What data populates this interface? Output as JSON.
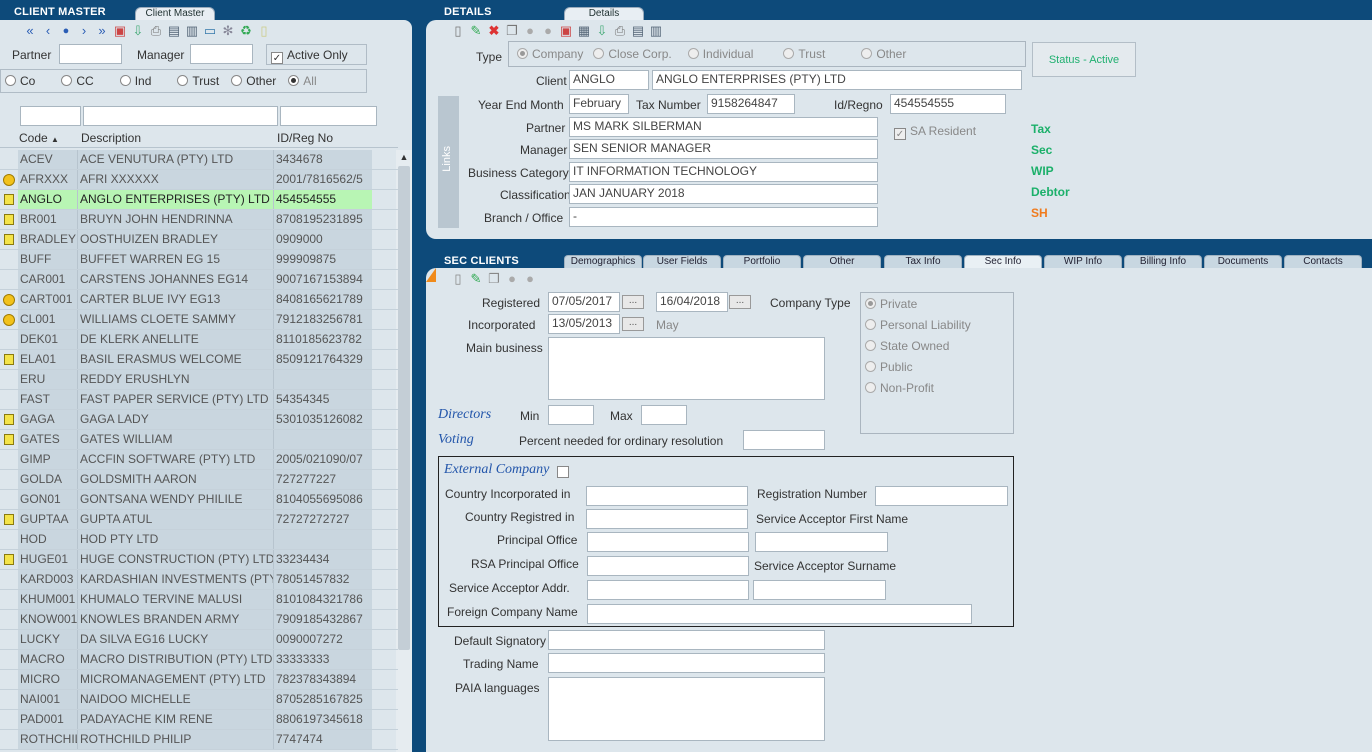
{
  "client_master": {
    "title": "CLIENT MASTER",
    "tab": "Client Master",
    "filters": {
      "partner_label": "Partner",
      "partner_value": "",
      "manager_label": "Manager",
      "manager_value": "",
      "active_only_label": "Active Only",
      "type_options": [
        "Co",
        "CC",
        "Ind",
        "Trust",
        "Other",
        "All"
      ],
      "type_selected": "All"
    },
    "columns": [
      "Code",
      "Description",
      "ID/Reg No"
    ],
    "rows": [
      {
        "icon": "",
        "code": "ACEV",
        "desc": "ACE VENUTURA (PTY) LTD",
        "id": "3434678"
      },
      {
        "icon": "face",
        "code": "AFRXXX",
        "desc": "AFRI XXXXXX",
        "id": "2001/7816562/5"
      },
      {
        "icon": "note",
        "code": "ANGLO",
        "desc": "ANGLO ENTERPRISES (PTY) LTD",
        "id": "454554555"
      },
      {
        "icon": "note",
        "code": "BR001",
        "desc": "BRUYN JOHN HENDRINNA",
        "id": "8708195231895"
      },
      {
        "icon": "note",
        "code": "BRADLEY",
        "desc": "OOSTHUIZEN BRADLEY",
        "id": "0909000"
      },
      {
        "icon": "",
        "code": "BUFF",
        "desc": "BUFFET WARREN EG 15",
        "id": "999909875"
      },
      {
        "icon": "",
        "code": "CAR001",
        "desc": "CARSTENS JOHANNES EG14",
        "id": "9007167153894"
      },
      {
        "icon": "face",
        "code": "CART001",
        "desc": "CARTER BLUE IVY EG13",
        "id": "8408165621789"
      },
      {
        "icon": "face",
        "code": "CL001",
        "desc": "WILLIAMS CLOETE SAMMY",
        "id": "7912183256781"
      },
      {
        "icon": "",
        "code": "DEK01",
        "desc": "DE KLERK ANELLITE",
        "id": "8110185623782"
      },
      {
        "icon": "note",
        "code": "ELA01",
        "desc": "BASIL ERASMUS WELCOME",
        "id": "8509121764329"
      },
      {
        "icon": "",
        "code": "ERU",
        "desc": "REDDY ERUSHLYN",
        "id": ""
      },
      {
        "icon": "",
        "code": "FAST",
        "desc": "FAST PAPER SERVICE (PTY) LTD",
        "id": "54354345"
      },
      {
        "icon": "note",
        "code": "GAGA",
        "desc": "GAGA LADY",
        "id": "5301035126082"
      },
      {
        "icon": "note",
        "code": "GATES",
        "desc": "GATES WILLIAM",
        "id": ""
      },
      {
        "icon": "",
        "code": "GIMP",
        "desc": "ACCFIN SOFTWARE (PTY) LTD",
        "id": "2005/021090/07"
      },
      {
        "icon": "",
        "code": "GOLDA",
        "desc": "GOLDSMITH AARON",
        "id": "727277227"
      },
      {
        "icon": "",
        "code": "GON01",
        "desc": "GONTSANA WENDY PHILILE",
        "id": "8104055695086"
      },
      {
        "icon": "note",
        "code": "GUPTAA",
        "desc": "GUPTA ATUL",
        "id": "72727272727"
      },
      {
        "icon": "",
        "code": "HOD",
        "desc": "HOD PTY LTD",
        "id": ""
      },
      {
        "icon": "note",
        "code": "HUGE01",
        "desc": "HUGE CONSTRUCTION (PTY) LTD",
        "id": "33234434"
      },
      {
        "icon": "",
        "code": "KARD003",
        "desc": "KARDASHIAN INVESTMENTS (PTY",
        "id": "78051457832"
      },
      {
        "icon": "",
        "code": "KHUM001",
        "desc": "KHUMALO TERVINE MALUSI",
        "id": "8101084321786"
      },
      {
        "icon": "",
        "code": "KNOW001",
        "desc": "KNOWLES BRANDEN ARMY",
        "id": "7909185432867"
      },
      {
        "icon": "",
        "code": "LUCKY",
        "desc": "DA SILVA EG16 LUCKY",
        "id": "0090007272"
      },
      {
        "icon": "",
        "code": "MACRO",
        "desc": "MACRO DISTRIBUTION (PTY) LTD",
        "id": "33333333"
      },
      {
        "icon": "",
        "code": "MICRO",
        "desc": "MICROMANAGEMENT (PTY) LTD",
        "id": "782378343894"
      },
      {
        "icon": "",
        "code": "NAI001",
        "desc": "NAIDOO MICHELLE",
        "id": "8705285167825"
      },
      {
        "icon": "",
        "code": "PAD001",
        "desc": "PADAYACHE KIM RENE",
        "id": "8806197345618"
      },
      {
        "icon": "",
        "code": "ROTHCHIL",
        "desc": "ROTHCHILD PHILIP",
        "id": "7747474"
      }
    ],
    "selected_code": "ANGLO"
  },
  "details": {
    "title": "DETAILS",
    "tab": "Details",
    "type_label": "Type",
    "type_options": [
      "Company",
      "Close Corp.",
      "Individual",
      "Trust",
      "Other"
    ],
    "type_selected": "Company",
    "status": "Status - Active",
    "links_label": "Links",
    "client_label": "Client",
    "client_code": "ANGLO",
    "client_name": "ANGLO ENTERPRISES (PTY) LTD",
    "year_end_label": "Year End Month",
    "year_end": "February",
    "tax_label": "Tax Number",
    "tax_number": "9158264847",
    "idreg_label": "Id/Regno",
    "idreg": "454554555",
    "partner_label": "Partner",
    "partner": "MS MARK SILBERMAN",
    "manager_label": "Manager",
    "manager": "SEN SENIOR MANAGER",
    "business_cat_label": "Business Category",
    "business_cat": "IT INFORMATION TECHNOLOGY",
    "classification_label": "Classification",
    "classification": "JAN JANUARY 2018",
    "branch_label": "Branch / Office",
    "branch": "-",
    "sa_resident_label": "SA Resident",
    "links": [
      "Tax",
      "Sec",
      "WIP",
      "Debtor",
      "SH"
    ]
  },
  "sec_clients": {
    "title": "SEC CLIENTS",
    "tabs": [
      "Demographics",
      "User Fields",
      "Portfolio",
      "Other",
      "Tax Info",
      "Sec Info",
      "WIP Info",
      "Billing Info",
      "Documents",
      "Contacts"
    ],
    "active_tab": "Sec Info",
    "registered_label": "Registered",
    "registered": "07/05/2017",
    "registered2": "16/04/2018",
    "incorporated_label": "Incorporated",
    "incorporated": "13/05/2013",
    "incorporated_month": "May",
    "main_business_label": "Main business",
    "company_type_label": "Company Type",
    "company_types": [
      "Private",
      "Personal Liability",
      "State Owned",
      "Public",
      "Non-Profit"
    ],
    "company_type_selected": "Private",
    "directors_label": "Directors",
    "min_label": "Min",
    "max_label": "Max",
    "voting_label": "Voting",
    "percent_label": "Percent needed for ordinary resolution",
    "external_company_label": "External Company",
    "country_inc_label": "Country Incorporated in",
    "reg_number_label": "Registration Number",
    "country_reg_label": "Country Registred in",
    "service_acceptor_first": "Service Acceptor  First Name",
    "principal_office_label": "Principal Office",
    "rsa_principal_label": "RSA Principal Office",
    "service_acceptor_surname": "Service Acceptor Surname",
    "service_acceptor_addr": "Service Acceptor Addr.",
    "foreign_company_label": "Foreign Company Name",
    "default_signatory_label": "Default Signatory",
    "trading_name_label": "Trading Name",
    "paia_label": "PAIA languages"
  }
}
